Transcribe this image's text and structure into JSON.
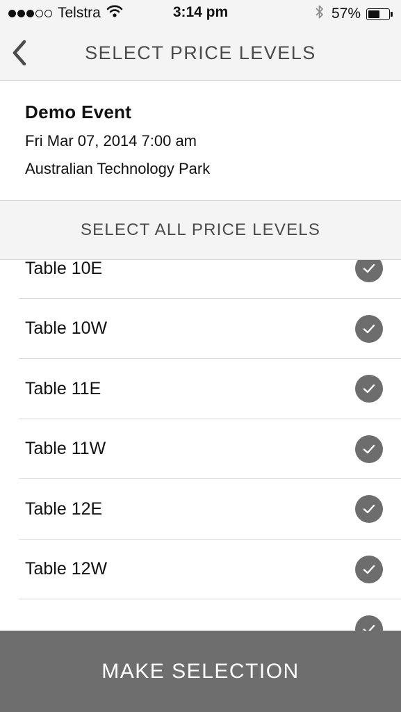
{
  "status_bar": {
    "signal_filled": 3,
    "signal_total": 5,
    "carrier": "Telstra",
    "time": "3:14 pm",
    "battery_text": "57%",
    "battery_level": 0.57,
    "icons": [
      "wifi-icon",
      "bluetooth-icon",
      "battery-icon"
    ]
  },
  "nav": {
    "title": "SELECT PRICE LEVELS",
    "back_icon": "chevron-left-icon"
  },
  "event": {
    "name": "Demo Event",
    "date": "Fri Mar 07, 2014 7:00 am",
    "venue": "Australian Technology Park"
  },
  "select_all_label": "SELECT ALL PRICE LEVELS",
  "price_levels": [
    {
      "label": "Table 10E",
      "selected": true
    },
    {
      "label": "Table 10W",
      "selected": true
    },
    {
      "label": "Table 11E",
      "selected": true
    },
    {
      "label": "Table 11W",
      "selected": true
    },
    {
      "label": "Table 12E",
      "selected": true
    },
    {
      "label": "Table 12W",
      "selected": true
    },
    {
      "label": "",
      "selected": true
    }
  ],
  "make_selection_label": "MAKE SELECTION",
  "colors": {
    "bar_background": "#f4f4f4",
    "check_circle": "#6d6d6d",
    "button_background": "#6e6e6e",
    "title_text": "#4a4a4a"
  }
}
